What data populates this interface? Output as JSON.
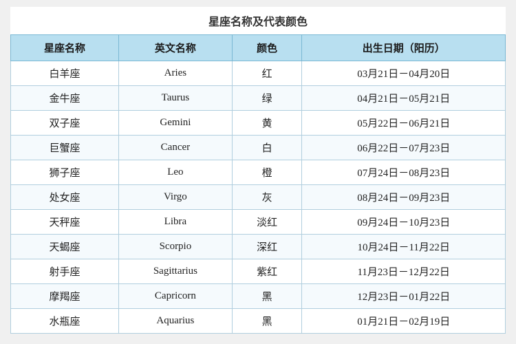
{
  "title": "星座名称及代表颜色",
  "headers": [
    "星座名称",
    "英文名称",
    "颜色",
    "出生日期（阳历）"
  ],
  "rows": [
    [
      "白羊座",
      "Aries",
      "红",
      "03月21日－04月20日"
    ],
    [
      "金牛座",
      "Taurus",
      "绿",
      "04月21日－05月21日"
    ],
    [
      "双子座",
      "Gemini",
      "黄",
      "05月22日－06月21日"
    ],
    [
      "巨蟹座",
      "Cancer",
      "白",
      "06月22日－07月23日"
    ],
    [
      "狮子座",
      "Leo",
      "橙",
      "07月24日－08月23日"
    ],
    [
      "处女座",
      "Virgo",
      "灰",
      "08月24日－09月23日"
    ],
    [
      "天秤座",
      "Libra",
      "淡红",
      "09月24日－10月23日"
    ],
    [
      "天蝎座",
      "Scorpio",
      "深红",
      "10月24日－11月22日"
    ],
    [
      "射手座",
      "Sagittarius",
      "紫红",
      "11月23日－12月22日"
    ],
    [
      "摩羯座",
      "Capricorn",
      "黑",
      "12月23日－01月22日"
    ],
    [
      "水瓶座",
      "Aquarius",
      "黑",
      "01月21日－02月19日"
    ]
  ]
}
